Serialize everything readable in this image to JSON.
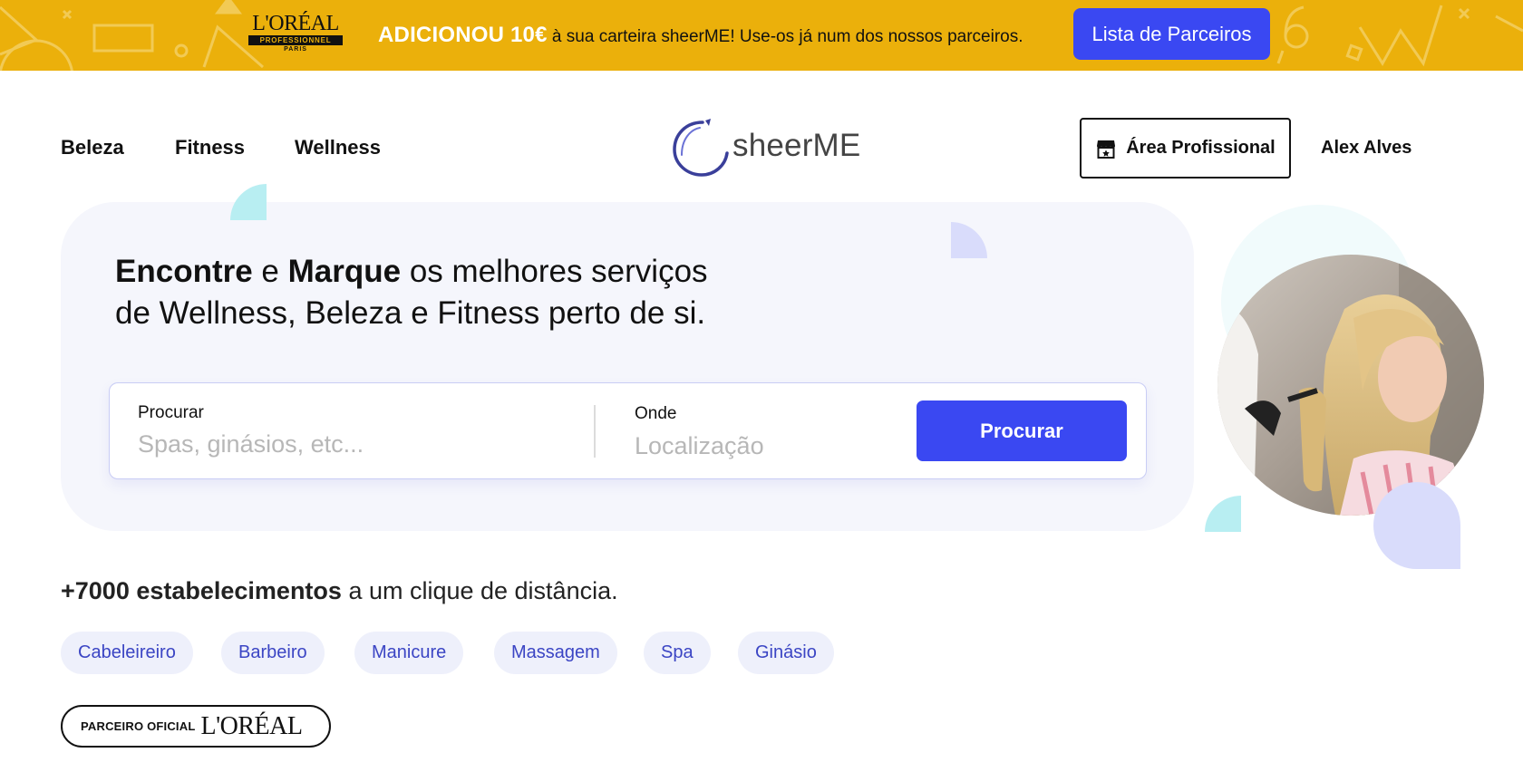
{
  "promo": {
    "brand_name": "L'ORÉAL",
    "brand_band": "PROFESSIONNEL",
    "brand_city": "PARIS",
    "headline": "ADICIONOU 10€",
    "message": " à sua carteira sheerME! Use-os já num dos nossos parceiros.",
    "button_label": "Lista de Parceiros",
    "bg_color": "#ebb00b"
  },
  "header": {
    "nav": [
      "Beleza",
      "Fitness",
      "Wellness"
    ],
    "logo_text": "sheerME",
    "pro_button_label": "Área Profissional",
    "pro_button_icon": "storefront-icon",
    "user_name": "Alex Alves"
  },
  "hero": {
    "headline_strong_1": "Encontre",
    "headline_and": " e ",
    "headline_strong_2": "Marque",
    "headline_rest": " os melhores serviços",
    "headline_line_2": "de Wellness, Beleza e Fitness perto de si.",
    "search": {
      "what_label": "Procurar",
      "what_placeholder": "Spas, ginásios, etc...",
      "where_label": "Onde",
      "where_placeholder": "Localização",
      "button_label": "Procurar"
    },
    "image": "salon-woman-hair-photo"
  },
  "stats": {
    "strong": "+7000 estabelecimentos",
    "rest": " a um clique de distância."
  },
  "categories": [
    "Cabeleireiro",
    "Barbeiro",
    "Manicure",
    "Massagem",
    "Spa",
    "Ginásio"
  ],
  "partner": {
    "label": "PARCEIRO OFICIAL",
    "logo": "L'ORÉAL"
  },
  "colors": {
    "accent": "#3a48f2",
    "chip_bg": "#eef0fb",
    "chip_text": "#3b45c4",
    "hero_bg": "#f5f6fc",
    "cyan_deco": "#b8eef2",
    "lavender_deco": "#d9dcfb"
  }
}
